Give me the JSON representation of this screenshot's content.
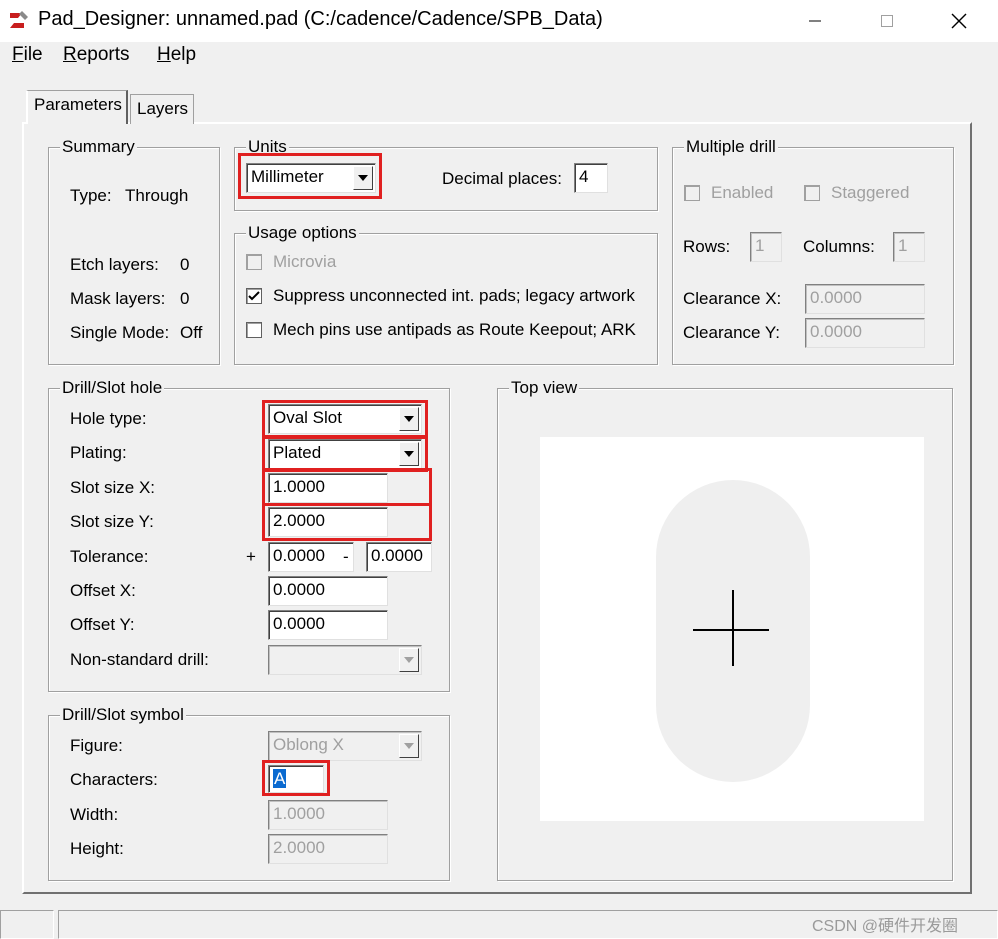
{
  "window": {
    "title": "Pad_Designer: unnamed.pad (C:/cadence/Cadence/SPB_Data)",
    "minimize": "—",
    "maximize": "□",
    "close": "✕"
  },
  "menu": [
    {
      "label": "File",
      "accel": "F",
      "rest": "ile"
    },
    {
      "label": "Reports",
      "accel": "R",
      "rest": "eports"
    },
    {
      "label": "Help",
      "accel": "H",
      "rest": "elp"
    }
  ],
  "tabs": {
    "parameters": "Parameters",
    "layers": "Layers"
  },
  "summary": {
    "title": "Summary",
    "type_label": "Type:",
    "type_value": "Through",
    "etch_label": "Etch layers:",
    "etch_value": "0",
    "mask_label": "Mask layers:",
    "mask_value": "0",
    "single_label": "Single Mode:",
    "single_value": "Off"
  },
  "units": {
    "title": "Units",
    "unit_value": "Millimeter",
    "decimal_label": "Decimal places:",
    "decimal_value": "4"
  },
  "usage": {
    "title": "Usage options",
    "microvia": "Microvia",
    "suppress": "Suppress unconnected int. pads; legacy artwork",
    "mech": "Mech pins use antipads as Route Keepout; ARK"
  },
  "multiple_drill": {
    "title": "Multiple drill",
    "enabled": "Enabled",
    "staggered": "Staggered",
    "rows_label": "Rows:",
    "rows_value": "1",
    "columns_label": "Columns:",
    "columns_value": "1",
    "clearance_x_label": "Clearance X:",
    "clearance_x_value": "0.0000",
    "clearance_y_label": "Clearance Y:",
    "clearance_y_value": "0.0000"
  },
  "drill_slot_hole": {
    "title": "Drill/Slot hole",
    "hole_type_label": "Hole type:",
    "hole_type_value": "Oval Slot",
    "plating_label": "Plating:",
    "plating_value": "Plated",
    "slot_x_label": "Slot size X:",
    "slot_x_value": "1.0000",
    "slot_y_label": "Slot size Y:",
    "slot_y_value": "2.0000",
    "tolerance_label": "Tolerance:",
    "tol_plus": "+",
    "tol_plus_value": "0.0000",
    "tol_minus": "-",
    "tol_minus_value": "0.0000",
    "offset_x_label": "Offset X:",
    "offset_x_value": "0.0000",
    "offset_y_label": "Offset Y:",
    "offset_y_value": "0.0000",
    "nonstd_label": "Non-standard drill:",
    "nonstd_value": ""
  },
  "drill_slot_symbol": {
    "title": "Drill/Slot symbol",
    "figure_label": "Figure:",
    "figure_value": "Oblong X",
    "characters_label": "Characters:",
    "characters_value": "A",
    "width_label": "Width:",
    "width_value": "1.0000",
    "height_label": "Height:",
    "height_value": "2.0000"
  },
  "top_view": {
    "title": "Top view"
  },
  "watermark": "CSDN @硬件开发圈",
  "colors": {
    "highlight": "#e02020",
    "selection": "#0a6ad0",
    "pad": "#efefef"
  },
  "icons": [
    "app-icon",
    "minimize-icon",
    "maximize-icon",
    "close-icon",
    "dropdown-arrow-icon",
    "checkmark-icon",
    "crosshair-icon"
  ]
}
